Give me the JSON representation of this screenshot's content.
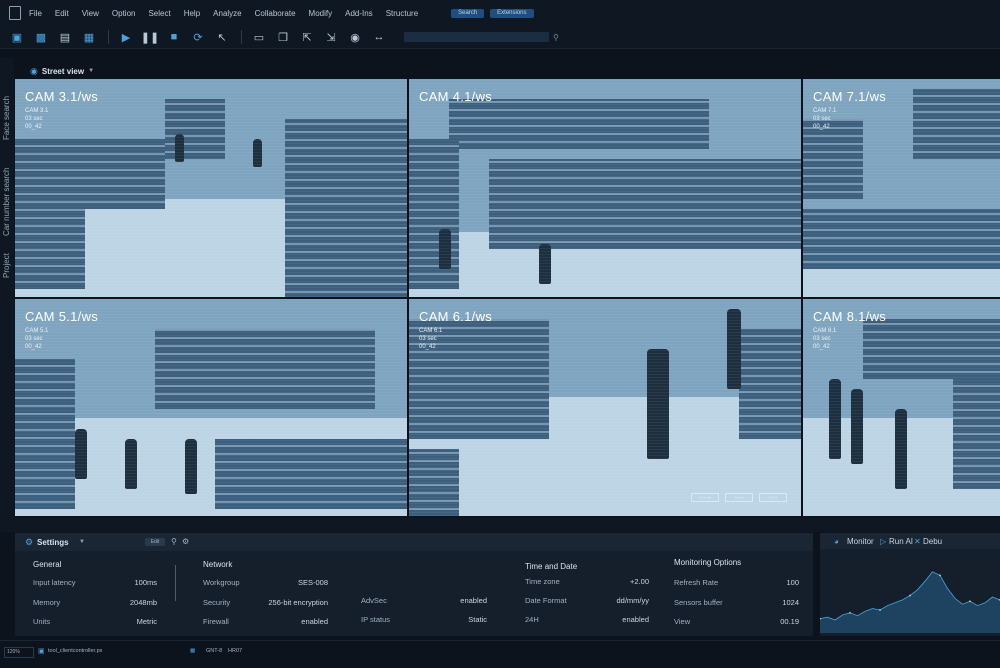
{
  "menu": {
    "items": [
      "File",
      "Edit",
      "View",
      "Option",
      "Select",
      "Help",
      "Analyze",
      "Collaborate",
      "Modify",
      "Add-Ins",
      "Structure"
    ],
    "pills": [
      "Search",
      "Extensions"
    ]
  },
  "toolbar": {
    "icons": [
      "cube-icon",
      "layers-icon",
      "save-icon",
      "sliders-icon",
      "play-icon",
      "pause-icon",
      "stop-icon",
      "refresh-icon",
      "pointer-icon",
      "window-icon",
      "copy-icon",
      "export-icon",
      "import-icon",
      "pin-icon",
      "arrows-icon"
    ]
  },
  "sidebar": {
    "tabs": [
      "Face search",
      "Car number search",
      "Project"
    ]
  },
  "view": {
    "label": "Street view"
  },
  "cameras": [
    {
      "title": "CAM 3.1/ws",
      "sub": [
        "CAM 3.1",
        "03 sec",
        "00_42"
      ]
    },
    {
      "title": "CAM 4.1/ws",
      "sub": [
        "CAM 4.1",
        "03 sec",
        "00_42"
      ]
    },
    {
      "title": "CAM 7.1/ws",
      "sub": [
        "CAM 7.1",
        "03 sec",
        "00_42"
      ]
    },
    {
      "title": "CAM 5.1/ws",
      "sub": [
        "CAM 5.1",
        "03 sec",
        "00_42"
      ]
    },
    {
      "title": "CAM 6.1/ws",
      "sub": [
        "CAM 6.1",
        "03 sec",
        "00_42"
      ]
    },
    {
      "title": "CAM 8.1/ws",
      "sub": [
        "CAM 8.1",
        "03 sec",
        "00_42"
      ]
    }
  ],
  "cam_buttons": [
    "ZOOM",
    "TRIM",
    "EDIT"
  ],
  "settings": {
    "title": "Settings",
    "edit_label": "Edit",
    "general": {
      "title": "General",
      "rows": [
        {
          "label": "Input latency",
          "value": "100ms"
        },
        {
          "label": "Memory",
          "value": "2048mb"
        },
        {
          "label": "Units",
          "value": "Metric"
        }
      ]
    },
    "network": {
      "title": "Network",
      "rows": [
        {
          "label": "Workgroup",
          "value": "SES-008"
        },
        {
          "label": "Security",
          "value": "256-bit encryption"
        },
        {
          "label": "Firewall",
          "value": "enabled"
        }
      ],
      "extra": [
        {
          "label": "AdvSec",
          "value": "enabled"
        },
        {
          "label": "IP status",
          "value": "Static"
        }
      ]
    },
    "time": {
      "title": "Time and Date",
      "rows": [
        {
          "label": "Time zone",
          "value": "+2.00"
        },
        {
          "label": "Date Format",
          "value": "dd/mm/yy"
        },
        {
          "label": "24H",
          "value": "enabled"
        }
      ]
    },
    "monitoring": {
      "title": "Monitoring Options",
      "rows": [
        {
          "label": "Refresh Rate",
          "value": "100"
        },
        {
          "label": "Sensors buffer",
          "value": "1024"
        },
        {
          "label": "View",
          "value": "00.19"
        }
      ]
    }
  },
  "monitor": {
    "tabs": [
      "Monitor",
      "Run AI",
      "Debu"
    ],
    "series": [
      0.2,
      0.22,
      0.18,
      0.25,
      0.28,
      0.24,
      0.3,
      0.34,
      0.32,
      0.38,
      0.42,
      0.46,
      0.52,
      0.6,
      0.72,
      0.85,
      0.8,
      0.62,
      0.48,
      0.4,
      0.44,
      0.38,
      0.42,
      0.5,
      0.46
    ]
  },
  "footer": {
    "zoom": "120%",
    "file": "tool_clientcontroller.px",
    "tags": [
      "GNT-8",
      "HR07"
    ]
  },
  "colors": {
    "accent": "#4aa3e0",
    "background": "#0c131c",
    "panel": "#141f2b"
  }
}
